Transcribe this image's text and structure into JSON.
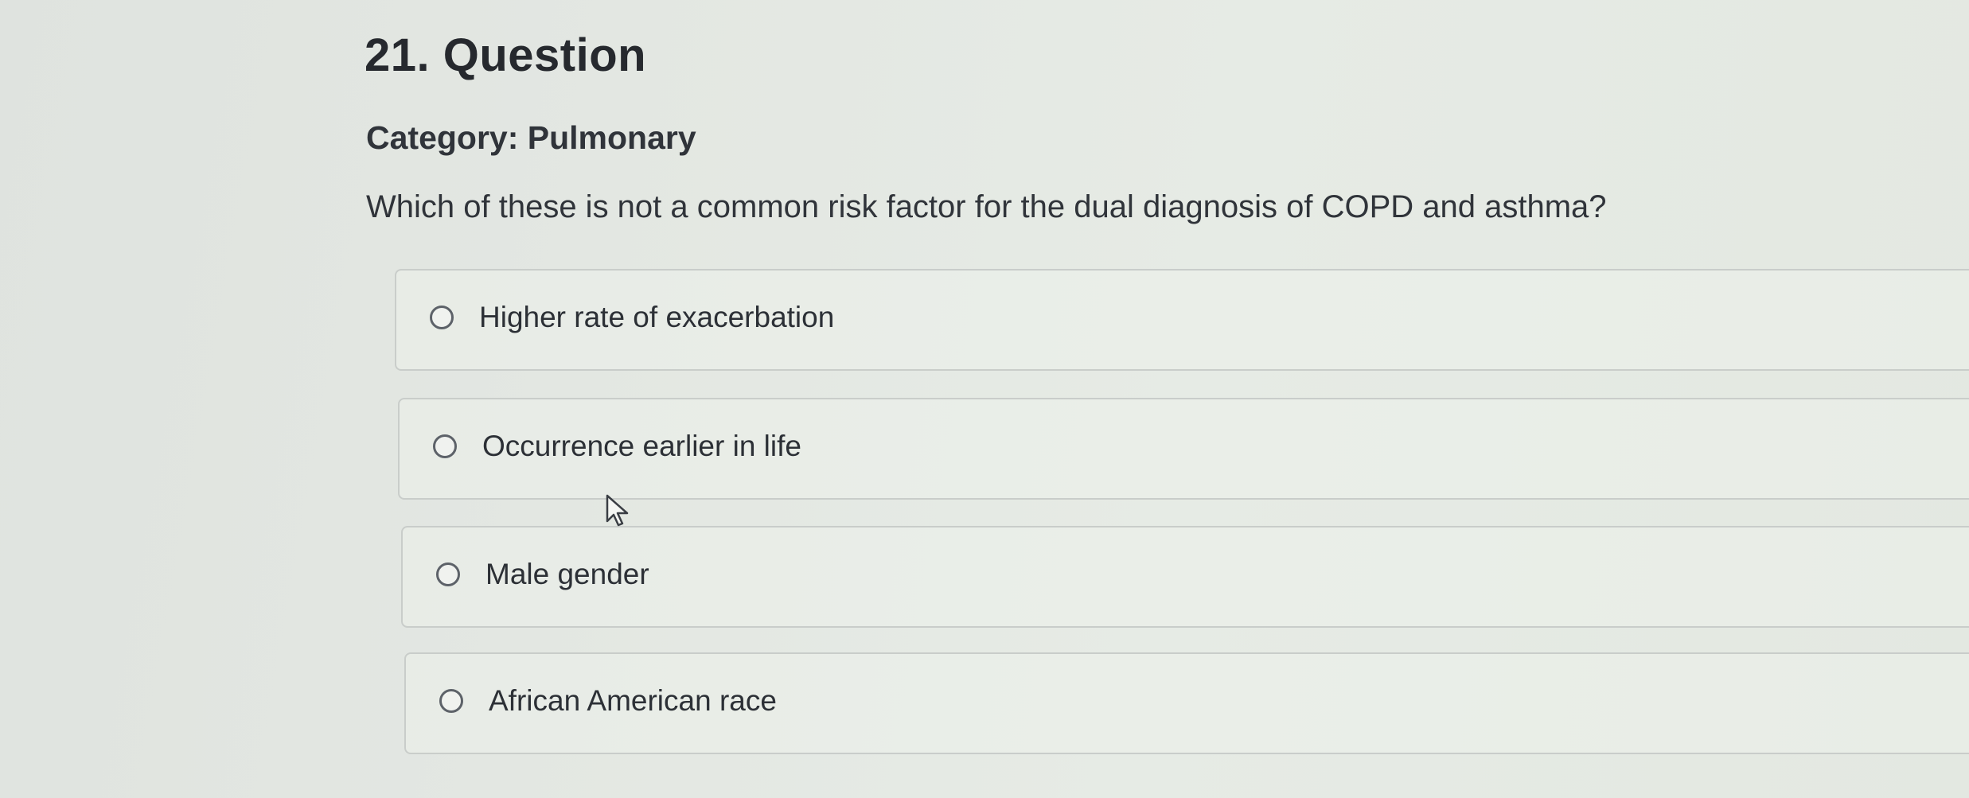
{
  "question": {
    "number_title": "21. Question",
    "category": "Category: Pulmonary",
    "prompt": "Which of these is not a common risk factor for the dual diagnosis of COPD and asthma?"
  },
  "options": [
    {
      "label": "Higher rate of exacerbation",
      "selected": false
    },
    {
      "label": "Occurrence earlier in life",
      "selected": false
    },
    {
      "label": "Male gender",
      "selected": false
    },
    {
      "label": "African American race",
      "selected": false
    }
  ],
  "icons": {
    "radio": "radio-unchecked-icon",
    "cursor": "mouse-pointer-icon"
  }
}
